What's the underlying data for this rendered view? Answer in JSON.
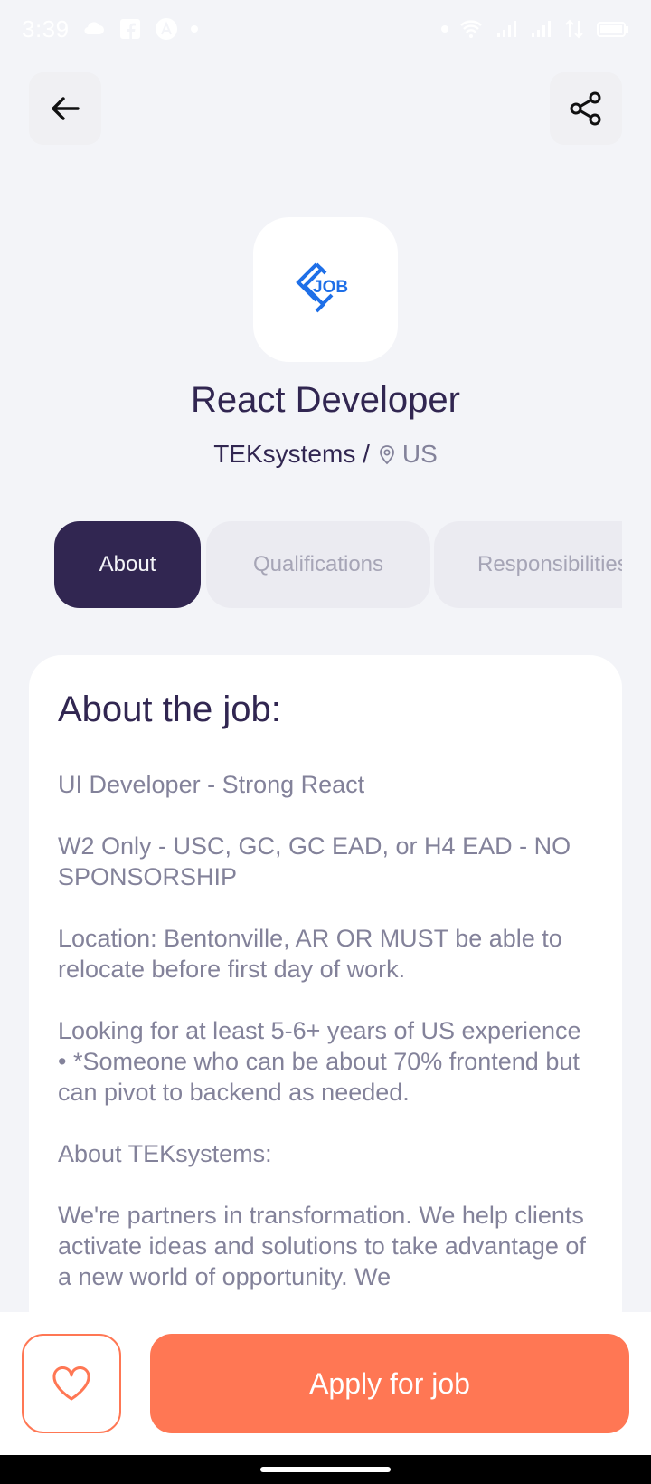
{
  "status_bar": {
    "time": "3:39",
    "icons_left": [
      "cloud-icon",
      "facebook-icon",
      "app-a-icon",
      "dot-icon"
    ],
    "icons_right": [
      "dot-icon",
      "wifi-icon",
      "signal-icon",
      "signal-icon",
      "data-icon",
      "battery-icon"
    ]
  },
  "header": {
    "back_icon": "arrow-left-icon",
    "share_icon": "share-icon"
  },
  "company": {
    "logo_text": "JOB",
    "job_title": "React Developer",
    "name": "TEKsystems /",
    "location": "US"
  },
  "tabs": [
    {
      "label": "About",
      "active": true
    },
    {
      "label": "Qualifications",
      "active": false
    },
    {
      "label": "Responsibilities",
      "active": false
    }
  ],
  "about": {
    "heading": "About the job:",
    "paragraphs": [
      "UI Developer - Strong React",
      "W2 Only - USC, GC, GC EAD, or H4 EAD - NO SPONSORSHIP",
      "Location: Bentonville, AR OR MUST be able to relocate before first day of work.",
      "Looking for at least 5-6+ years of US experience\n• *Someone who can be about 70% frontend but can pivot to backend as needed.",
      "About TEKsystems:",
      "We're partners in transformation. We help clients activate ideas and solutions to take advantage of a new world of opportunity. We"
    ]
  },
  "footer": {
    "favorite_icon": "heart-icon",
    "apply_label": "Apply for job"
  },
  "colors": {
    "primary": "#312651",
    "accent": "#ff7754",
    "background": "#f3f4f8",
    "muted_text": "#83829a"
  }
}
